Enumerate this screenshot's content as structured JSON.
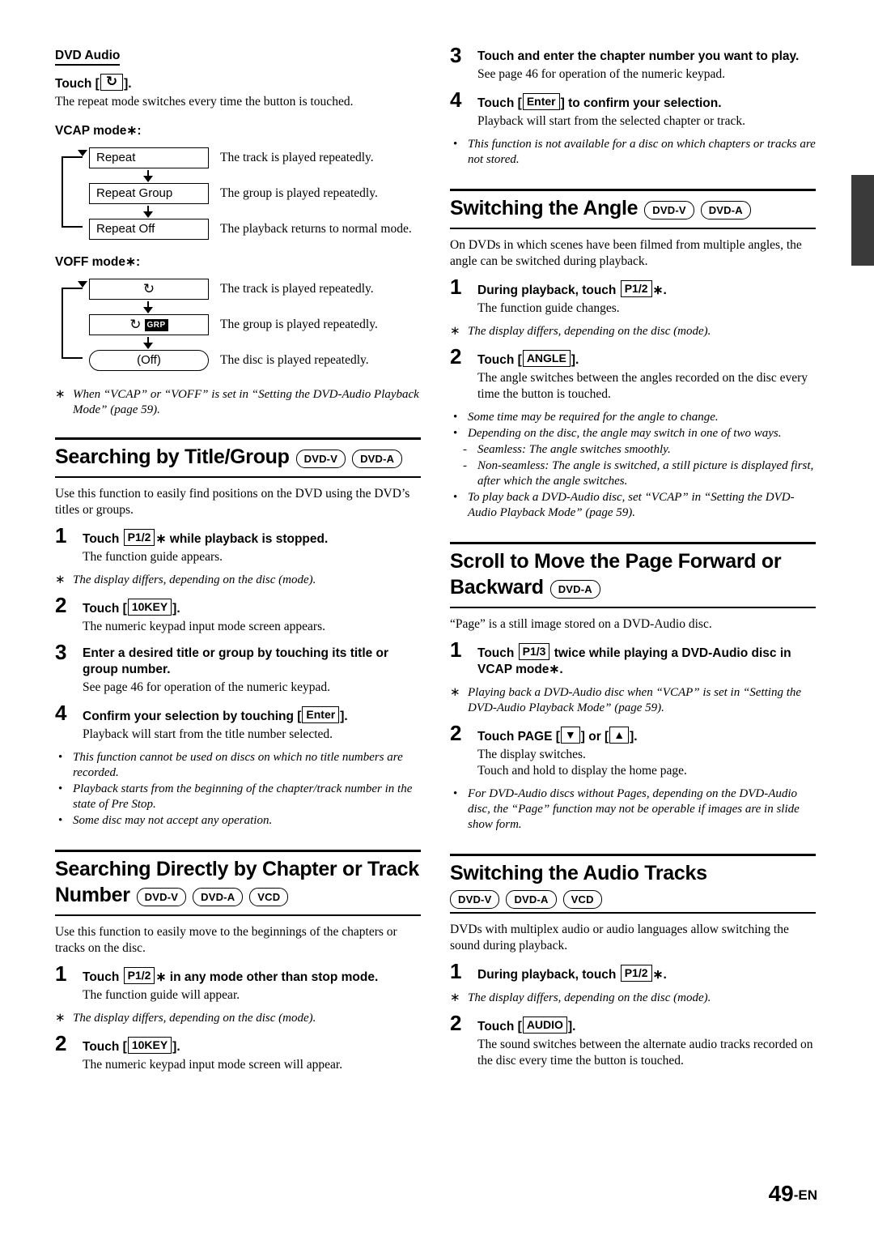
{
  "page": {
    "folio_number": "49",
    "folio_suffix": "-EN"
  },
  "left": {
    "dvd_audio": {
      "heading": "DVD Audio",
      "touch_label": "Touch [",
      "touch_label_end": "].",
      "repeat_icon": "repeat-icon",
      "desc": "The repeat mode switches every time the button is touched.",
      "vcap_label": "VCAP mode∗:",
      "voff_label": "VOFF mode∗:",
      "vcap_flow": [
        {
          "box": "Repeat",
          "desc": "The track is played repeatedly."
        },
        {
          "box": "Repeat Group",
          "desc": "The group is played repeatedly."
        },
        {
          "box": "Repeat Off",
          "desc": "The playback returns to normal mode."
        }
      ],
      "voff_flow": [
        {
          "box": "",
          "icon": "repeat-icon",
          "desc": "The track is played repeatedly."
        },
        {
          "box": "",
          "icon": "repeat-group-icon",
          "chip": "GRP",
          "desc": "The group is played repeatedly."
        },
        {
          "box": "(Off)",
          "desc": "The disc is played repeatedly."
        }
      ],
      "footnote": "When “VCAP” or “VOFF” is set in “Setting the DVD-Audio Playback Mode” (page 59)."
    },
    "searching_title_group": {
      "heading": "Searching by Title/Group",
      "badges": [
        "DVD-V",
        "DVD-A"
      ],
      "intro": "Use this function to easily find positions on the DVD using the DVD’s titles or groups.",
      "steps": [
        {
          "num": "1",
          "title_parts": [
            "Touch ",
            "P1/2",
            "∗ while playback is stopped."
          ],
          "key": "P1/2",
          "body": "The function guide appears.",
          "note": "The display differs, depending on the disc (mode)."
        },
        {
          "num": "2",
          "title_parts": [
            "Touch [",
            "10KEY",
            "]."
          ],
          "key": "10KEY",
          "body": "The numeric keypad input mode screen appears."
        },
        {
          "num": "3",
          "title_plain": "Enter a desired title or group by touching its title or group number.",
          "body": "See page 46 for operation of the numeric keypad."
        },
        {
          "num": "4",
          "title_parts": [
            "Confirm your selection by touching [",
            "Enter",
            "]."
          ],
          "key": "Enter",
          "body": "Playback will start from the title number selected."
        }
      ],
      "bullets": [
        "This function cannot be used on discs on which no title numbers are recorded.",
        "Playback starts from the beginning of the chapter/track number in the state of Pre Stop.",
        "Some disc may not accept any operation."
      ]
    },
    "searching_chapter": {
      "heading_line1": "Searching Directly by Chapter or Track",
      "heading_line2": "Number",
      "badges": [
        "DVD-V",
        "DVD-A",
        "VCD"
      ],
      "intro": "Use this function to easily move to the beginnings of the chapters or tracks on the disc.",
      "steps": [
        {
          "num": "1",
          "title_parts": [
            "Touch ",
            "P1/2",
            "∗ in any mode other than stop mode."
          ],
          "key": "P1/2",
          "body": "The function guide will appear.",
          "note": "The display differs, depending on the disc (mode)."
        },
        {
          "num": "2",
          "title_parts": [
            "Touch [",
            "10KEY",
            "]."
          ],
          "key": "10KEY",
          "body": "The numeric keypad input mode screen will appear."
        }
      ]
    }
  },
  "right": {
    "top_steps": [
      {
        "num": "3",
        "title_plain": "Touch and enter the chapter number you want to play.",
        "body": "See page 46 for operation of the numeric keypad."
      },
      {
        "num": "4",
        "title_parts": [
          "Touch [",
          "Enter",
          "] to confirm your selection."
        ],
        "key": "Enter",
        "body": "Playback will start from the selected chapter or track."
      }
    ],
    "top_bullets": [
      "This function is not available for a disc on which chapters or tracks are not stored."
    ],
    "angle": {
      "heading": "Switching the Angle",
      "badges": [
        "DVD-V",
        "DVD-A"
      ],
      "intro": "On DVDs in which scenes have been filmed from multiple angles, the angle can be switched during playback.",
      "steps": [
        {
          "num": "1",
          "title_parts": [
            "During playback, touch ",
            "P1/2",
            "∗."
          ],
          "key": "P1/2",
          "body": "The function guide changes.",
          "note": "The display differs, depending on the disc (mode)."
        },
        {
          "num": "2",
          "title_parts": [
            "Touch [",
            "ANGLE",
            "]."
          ],
          "key": "ANGLE",
          "body": "The angle switches between the angles recorded on the disc every time the button is touched."
        }
      ],
      "bullets": [
        "Some time may be required for the angle to change.",
        "Depending on the disc, the angle may switch in one of two ways."
      ],
      "sub_bullets": [
        "Seamless: The angle switches smoothly.",
        "Non-seamless: The angle is switched, a still picture is displayed first, after which the angle switches."
      ],
      "bullets_after": [
        "To play back a DVD-Audio disc, set “VCAP” in “Setting the DVD-Audio Playback Mode” (page 59)."
      ]
    },
    "scroll": {
      "heading_line1": "Scroll to Move the Page Forward or",
      "heading_line2": "Backward",
      "badges": [
        "DVD-A"
      ],
      "intro": "“Page” is a still image stored on a DVD-Audio disc.",
      "steps": [
        {
          "num": "1",
          "title_parts": [
            "Touch ",
            "P1/3",
            " twice while playing a DVD-Audio disc in VCAP mode∗."
          ],
          "key": "P1/3",
          "note": "Playing back a DVD-Audio disc when “VCAP” is set in “Setting the DVD-Audio Playback Mode” (page 59)."
        },
        {
          "num": "2",
          "title_parts": [
            "Touch PAGE [",
            "▼",
            "] or [",
            "▲",
            "]."
          ],
          "body_line1": "The display switches.",
          "body_line2": "Touch and hold to display the home page."
        }
      ],
      "bullets": [
        "For DVD-Audio discs without Pages, depending on the DVD-Audio disc, the “Page” function may not be operable if images are in slide show form."
      ]
    },
    "audio_tracks": {
      "heading": "Switching the Audio Tracks",
      "badges": [
        "DVD-V",
        "DVD-A",
        "VCD"
      ],
      "intro": "DVDs with multiplex audio or audio languages allow switching the sound during playback.",
      "steps": [
        {
          "num": "1",
          "title_parts": [
            "During playback, touch ",
            "P1/2",
            "∗."
          ],
          "key": "P1/2",
          "note": "The display differs, depending on the disc (mode)."
        },
        {
          "num": "2",
          "title_parts": [
            "Touch [",
            "AUDIO",
            "]."
          ],
          "key": "AUDIO",
          "body": "The sound switches between the alternate audio tracks recorded on the disc every time the button is touched."
        }
      ]
    }
  }
}
